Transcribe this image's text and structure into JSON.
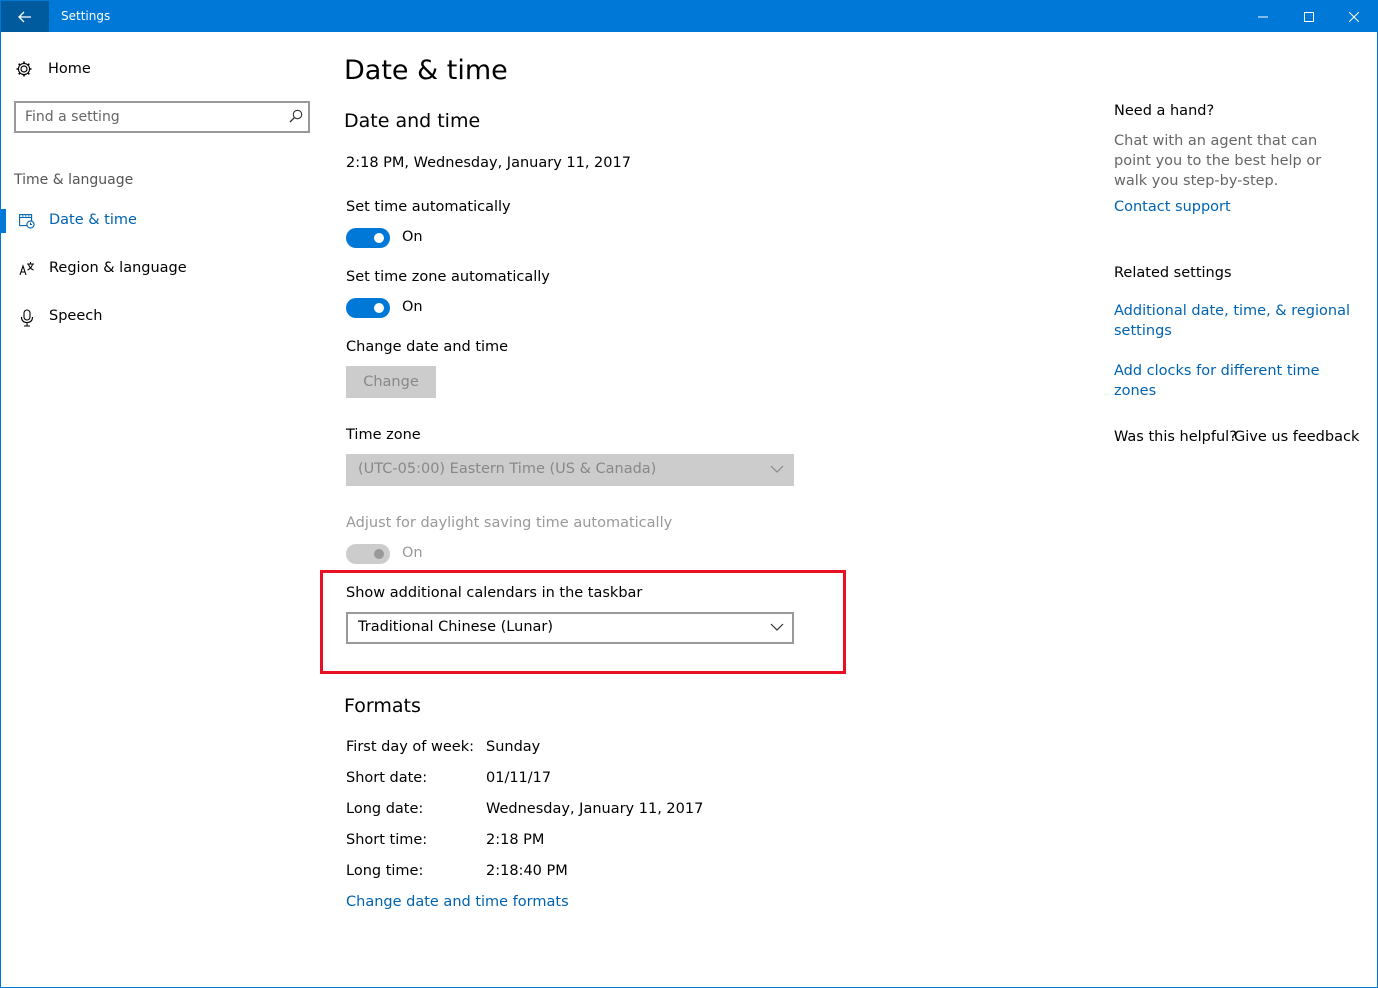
{
  "window": {
    "title": "Settings"
  },
  "sidebar": {
    "home_label": "Home",
    "search_placeholder": "Find a setting",
    "section_label": "Time & language",
    "items": [
      {
        "label": "Date & time",
        "icon": "calendar-clock-icon",
        "active": true
      },
      {
        "label": "Region & language",
        "icon": "region-language-icon",
        "active": false
      },
      {
        "label": "Speech",
        "icon": "microphone-icon",
        "active": false
      }
    ]
  },
  "main": {
    "page_title": "Date & time",
    "section_date_time": "Date and time",
    "current_datetime": "2:18 PM, Wednesday, January 11, 2017",
    "set_time_auto": {
      "label": "Set time automatically",
      "state": "On"
    },
    "set_timezone_auto": {
      "label": "Set time zone automatically",
      "state": "On"
    },
    "change_date_time": {
      "label": "Change date and time",
      "button": "Change"
    },
    "time_zone": {
      "label": "Time zone",
      "value": "(UTC-05:00) Eastern Time (US & Canada)"
    },
    "daylight_saving": {
      "label": "Adjust for daylight saving time automatically",
      "state": "On"
    },
    "additional_calendars": {
      "label": "Show additional calendars in the taskbar",
      "value": "Traditional Chinese (Lunar)"
    },
    "formats": {
      "heading": "Formats",
      "rows": [
        {
          "label": "First day of week:",
          "value": "Sunday"
        },
        {
          "label": "Short date:",
          "value": "01/11/17"
        },
        {
          "label": "Long date:",
          "value": "Wednesday, January 11, 2017"
        },
        {
          "label": "Short time:",
          "value": "2:18 PM"
        },
        {
          "label": "Long time:",
          "value": "2:18:40 PM"
        }
      ],
      "change_link": "Change date and time formats"
    }
  },
  "right_pane": {
    "need_hand_heading": "Need a hand?",
    "need_hand_text": "Chat with an agent that can point you to the best help or walk you step-by-step.",
    "contact_support": "Contact support",
    "related_heading": "Related settings",
    "related_link_1": "Additional date, time, & regional settings",
    "related_link_2": "Add clocks for different time zones",
    "helpful_text": "Was this helpful?",
    "feedback_link": "Give us feedback"
  },
  "colors": {
    "accent": "#0078d7",
    "link": "#0063b1",
    "highlight": "#e81123"
  }
}
